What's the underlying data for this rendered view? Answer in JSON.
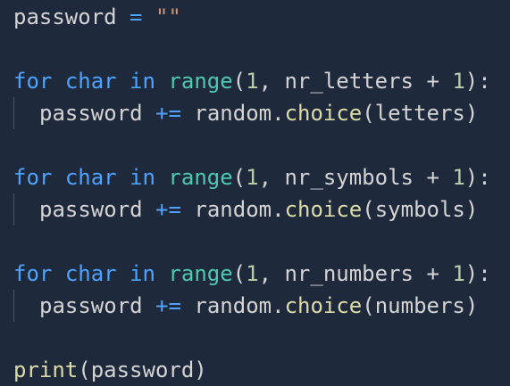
{
  "theme": {
    "background": "#1e293b",
    "keyword_color": "#4da3ff",
    "builtin_color": "#4ec9b0",
    "number_color": "#b5cea8",
    "string_color": "#ce9178",
    "method_color": "#dcdcaa",
    "operator_color": "#4da3ff",
    "text_color": "#d4d4d4"
  },
  "code": {
    "line1": {
      "var": "password",
      "op": "=",
      "value": "\"\""
    },
    "loop1": {
      "kw_for": "for",
      "var": "char",
      "kw_in": "in",
      "fn": "range",
      "paren_open": "(",
      "start": "1",
      "sep": ",",
      "limit": "nr_letters",
      "plus": "+",
      "step": "1",
      "paren_close": "):"
    },
    "body1": {
      "target": "password",
      "op": "+=",
      "obj": "random.",
      "method": "choice",
      "paren_open": "(",
      "arg": "letters",
      "paren_close": ")"
    },
    "loop2": {
      "kw_for": "for",
      "var": "char",
      "kw_in": "in",
      "fn": "range",
      "paren_open": "(",
      "start": "1",
      "sep": ",",
      "limit": "nr_symbols",
      "plus": "+",
      "step": "1",
      "paren_close": "):"
    },
    "body2": {
      "target": "password",
      "op": "+=",
      "obj": "random.",
      "method": "choice",
      "paren_open": "(",
      "arg": "symbols",
      "paren_close": ")"
    },
    "loop3": {
      "kw_for": "for",
      "var": "char",
      "kw_in": "in",
      "fn": "range",
      "paren_open": "(",
      "start": "1",
      "sep": ",",
      "limit": "nr_numbers",
      "plus": "+",
      "step": "1",
      "paren_close": "):"
    },
    "body3": {
      "target": "password",
      "op": "+=",
      "obj": "random.",
      "method": "choice",
      "paren_open": "(",
      "arg": "numbers",
      "paren_close": ")"
    },
    "print": {
      "fn": "print",
      "paren_open": "(",
      "arg": "password",
      "paren_close": ")"
    }
  }
}
